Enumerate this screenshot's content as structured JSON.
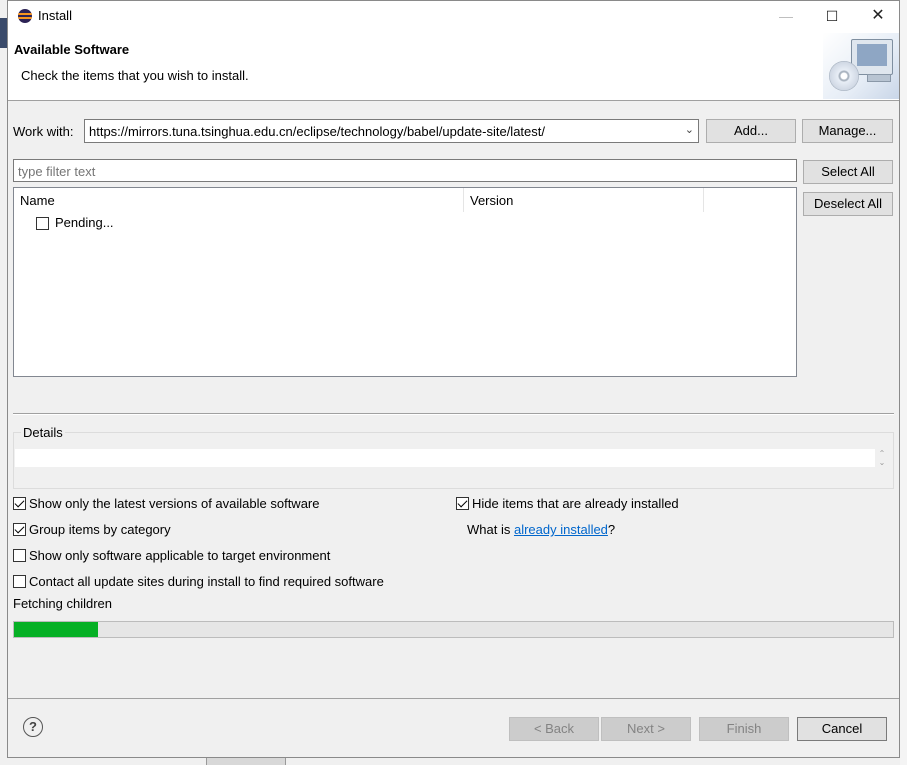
{
  "window": {
    "title": "Install",
    "min_glyph": "—",
    "max_glyph": "☐",
    "close_glyph": "✕"
  },
  "header": {
    "title": "Available Software",
    "subtitle": "Check the items that you wish to install."
  },
  "work_with": {
    "label": "Work with:",
    "value": "https://mirrors.tuna.tsinghua.edu.cn/eclipse/technology/babel/update-site/latest/",
    "add_label": "Add...",
    "manage_label": "Manage..."
  },
  "filter": {
    "placeholder": "type filter text"
  },
  "buttons": {
    "select_all": "Select All",
    "deselect_all": "Deselect All"
  },
  "tree": {
    "columns": [
      "Name",
      "Version"
    ],
    "rows": [
      {
        "label": "Pending...",
        "checked": false
      }
    ]
  },
  "details": {
    "title": "Details",
    "text": ""
  },
  "options": {
    "show_latest": {
      "label": "Show only the latest versions of available software",
      "checked": true
    },
    "group_by_category": {
      "label": "Group items by category",
      "checked": true
    },
    "show_applicable": {
      "label": "Show only software applicable to target environment",
      "checked": false
    },
    "contact_all_sites": {
      "label": "Contact all update sites during install to find required software",
      "checked": false
    },
    "hide_installed": {
      "label": "Hide items that are already installed",
      "checked": true
    },
    "what_is_prefix": "What is ",
    "what_is_link": "already installed",
    "what_is_suffix": "?"
  },
  "status": {
    "text": "Fetching children",
    "progress_fraction": 0.095
  },
  "footer": {
    "help_glyph": "?",
    "back": "< Back",
    "next": "Next >",
    "finish": "Finish",
    "cancel": "Cancel"
  },
  "colors": {
    "progress_fill": "#06b025",
    "link": "#0066cc"
  },
  "icons": [
    "eclipse-app-icon",
    "minimize-icon",
    "maximize-icon",
    "close-icon",
    "install-banner-icon",
    "dropdown-arrow-icon",
    "help-icon"
  ]
}
